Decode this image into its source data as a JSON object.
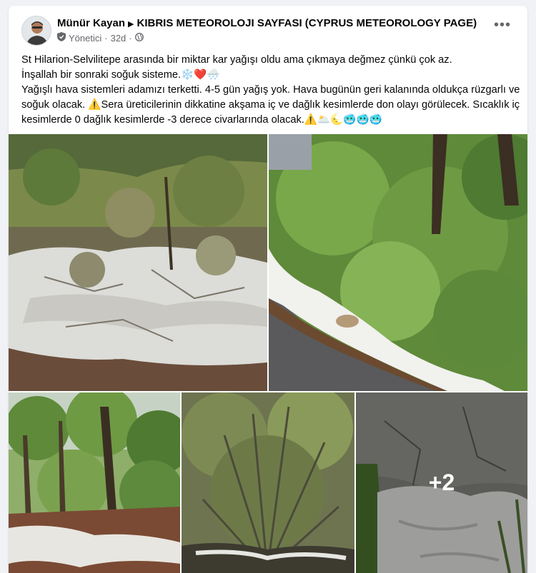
{
  "post": {
    "author": "Münür Kayan",
    "group": "KIBRIS METEOROLOJI SAYFASI (CYPRUS METEOROLOGY PAGE)",
    "role": "Yönetici",
    "time": "32d",
    "lines": [
      "St Hilarion-Selvilitepe arasında bir miktar kar yağışı oldu ama çıkmaya değmez çünkü çok az.",
      "İnşallah bir sonraki soğuk sisteme.❄️❤️🌨️",
      "Yağışlı hava sistemleri adamızı terketti. 4-5 gün yağış yok. Hava bugünün geri kalanında oldukça rüzgarlı ve soğuk olacak. ⚠️Sera üreticilerinin dikkatine akşama iç ve dağlık kesimlerde don olayı görülecek. Sıcaklık iç kesimlerde 0 dağlık kesimlerde -3 derece civarlarında olacak.⚠️🌥️🌜🥶🥶🥶"
    ]
  },
  "photos": {
    "more_count": "+2"
  },
  "icons": {
    "avatar": "avatar",
    "group_arrow": "triangle-right-icon",
    "admin_badge": "shield-icon",
    "privacy": "globe-icon",
    "menu": "more-dots-icon"
  }
}
